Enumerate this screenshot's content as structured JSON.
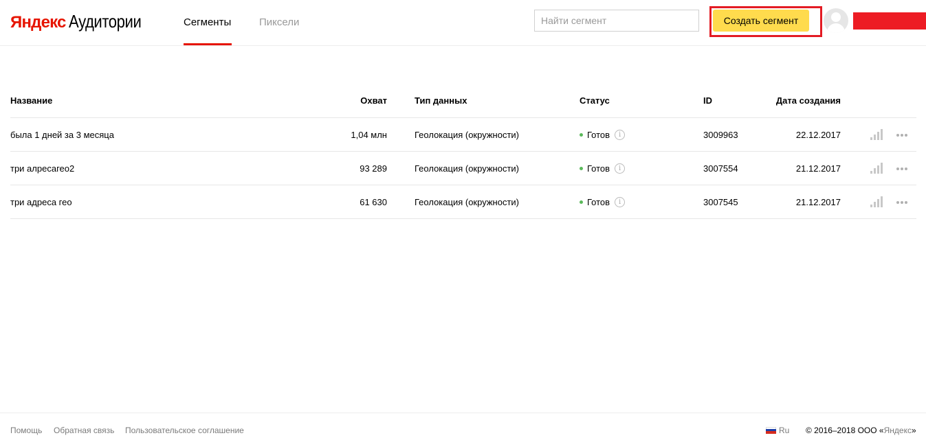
{
  "header": {
    "logo_brand": "Яндекс",
    "logo_product": "Аудитории",
    "tabs": [
      {
        "label": "Сегменты",
        "active": true
      },
      {
        "label": "Пиксели",
        "active": false
      }
    ],
    "search": {
      "placeholder": "Найти сегмент",
      "value": ""
    },
    "create_button_label": "Создать сегмент",
    "accent_color": "#e61400",
    "button_color": "#ffdb4d"
  },
  "table": {
    "columns": [
      "Название",
      "Охват",
      "Тип данных",
      "Статус",
      "ID",
      "Дата создания"
    ],
    "rows": [
      {
        "name": "была 1 дней за 3 месяца",
        "reach": "1,04 млн",
        "type": "Геолокация (окружности)",
        "status": "Готов",
        "id": "3009963",
        "date": "22.12.2017"
      },
      {
        "name": "три алресагео2",
        "reach": "93 289",
        "type": "Геолокация (окружности)",
        "status": "Готов",
        "id": "3007554",
        "date": "21.12.2017"
      },
      {
        "name": "три адреса гео",
        "reach": "61 630",
        "type": "Геолокация (окружности)",
        "status": "Готов",
        "id": "3007545",
        "date": "21.12.2017"
      }
    ],
    "status_color": "#5bb95b",
    "row_icons": [
      "chart-icon",
      "more-icon"
    ]
  },
  "footer": {
    "links": [
      "Помощь",
      "Обратная связь",
      "Пользовательское соглашение"
    ],
    "language": "Ru",
    "copyright_prefix": "© 2016–2018  ООО «",
    "copyright_link": "Яндекс",
    "copyright_suffix": "»"
  }
}
